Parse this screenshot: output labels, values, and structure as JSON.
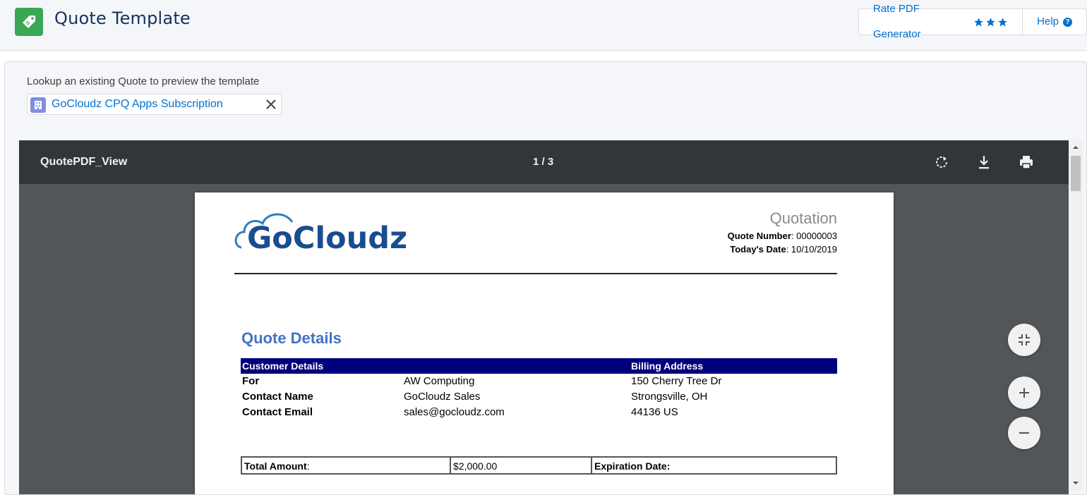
{
  "header": {
    "title": "Quote Template",
    "rate_label": "Rate PDF Generator",
    "help_label": "Help",
    "app_icon": "price-tag-icon",
    "accent_color": "#3ba755"
  },
  "lookup": {
    "label": "Lookup an existing Quote to preview the template",
    "selected": "GoCloudz CPQ Apps Subscription"
  },
  "viewer": {
    "doc_name": "QuotePDF_View",
    "page_indicator": "1 / 3"
  },
  "document": {
    "logo_text": "GoCloudz",
    "heading": "Quotation",
    "quote_number_label": "Quote Number",
    "quote_number": ": 00000003",
    "date_label": "Today's Date",
    "date": ": 10/10/2019",
    "section_title": "Quote Details",
    "customer_header": "Customer Details",
    "billing_header": "Billing Address",
    "rows": [
      {
        "label": "For",
        "value": "AW Computing",
        "address": "150 Cherry Tree Dr"
      },
      {
        "label": "Contact Name",
        "value": "GoCloudz Sales",
        "address": "Strongsville, OH"
      },
      {
        "label": "Contact Email",
        "value": "sales@gocloudz.com",
        "address": "44136 US"
      }
    ],
    "total_label": "Total Amount",
    "total_colon": ":",
    "total_value": "$2,000.00",
    "expiration_label": "Expiration Date:",
    "header_band_color": "#00007d",
    "title_color": "#4472c4"
  }
}
